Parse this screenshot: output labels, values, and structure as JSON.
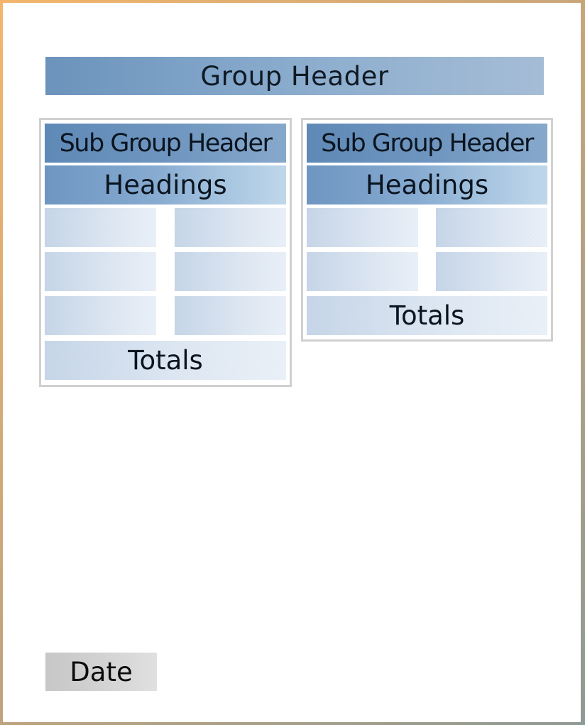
{
  "group_header": {
    "label": "Group Header"
  },
  "subgroups": [
    {
      "title": "Sub Group Header",
      "headings": "Headings",
      "totals": "Totals"
    },
    {
      "title": "Sub Group Header",
      "headings": "Headings",
      "totals": "Totals"
    }
  ],
  "footer": {
    "date_label": "Date"
  },
  "colors": {
    "group_header": "#7ba0c6",
    "sub_header": "#6e95bf",
    "headings": "#86aad0",
    "cell": "#d6e1ee",
    "date_box": "#d2d2d2",
    "border": "#d0d0d0"
  }
}
